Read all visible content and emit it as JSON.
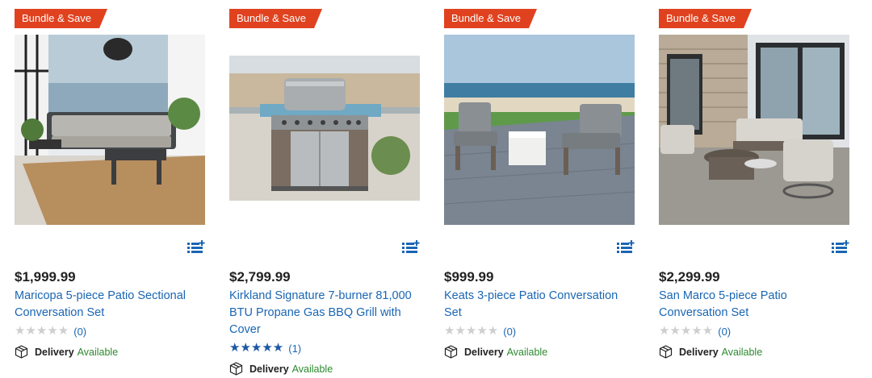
{
  "products": [
    {
      "badge": "Bundle & Save",
      "price": "$1,999.99",
      "title": "Maricopa 5-piece Patio Sectional Conversation Set",
      "rating_count": "(0)",
      "rating": 0,
      "delivery_label": "Delivery",
      "delivery_status": "Available"
    },
    {
      "badge": "Bundle & Save",
      "price": "$2,799.99",
      "title": "Kirkland Signature 7-burner 81,000 BTU Propane Gas BBQ Grill with Cover",
      "rating_count": "(1)",
      "rating": 5,
      "delivery_label": "Delivery",
      "delivery_status": "Available"
    },
    {
      "badge": "Bundle & Save",
      "price": "$999.99",
      "title": "Keats 3-piece Patio Conversation Set",
      "rating_count": "(0)",
      "rating": 0,
      "delivery_label": "Delivery",
      "delivery_status": "Available"
    },
    {
      "badge": "Bundle & Save",
      "price": "$2,299.99",
      "title": "San Marco 5-piece Patio Conversation Set",
      "rating_count": "(0)",
      "rating": 0,
      "delivery_label": "Delivery",
      "delivery_status": "Available"
    }
  ],
  "icons": {
    "compare": "add-to-list-icon",
    "delivery": "box-icon",
    "star": "star-icon"
  },
  "colors": {
    "badge": "#e0421f",
    "link": "#1a66b3",
    "available": "#2c8a2f",
    "star_full": "#1c57a5",
    "star_empty": "#cfcfcf"
  }
}
